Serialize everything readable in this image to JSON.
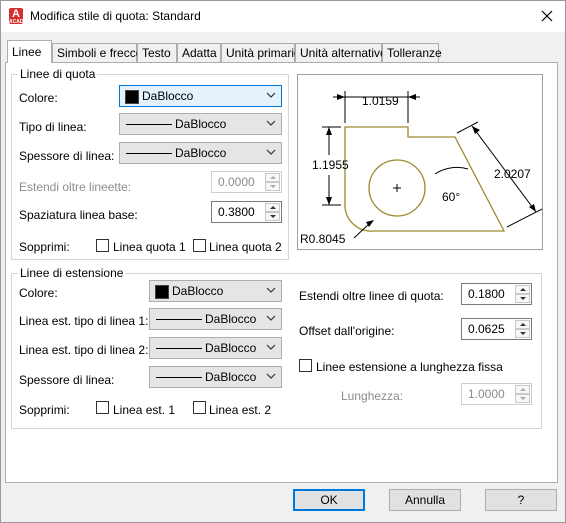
{
  "window": {
    "title": "Modifica stile di quota: Standard",
    "app_icon_letter": "A",
    "app_icon_sub": "ACAD"
  },
  "tabs": [
    "Linee",
    "Simboli e frecce",
    "Testo",
    "Adatta",
    "Unità primarie",
    "Unità alternative",
    "Tolleranze"
  ],
  "active_tab": "Linee",
  "dim_lines": {
    "group_title": "Linee di quota",
    "color_label": "Colore:",
    "color_value": "DaBlocco",
    "linetype_label": "Tipo di linea:",
    "linetype_value": "DaBlocco",
    "lineweight_label": "Spessore di linea:",
    "lineweight_value": "DaBlocco",
    "extend_label": "Estendi oltre lineette:",
    "extend_value": "0.0000",
    "baseline_label": "Spaziatura linea base:",
    "baseline_value": "0.3800",
    "suppress_label": "Sopprimi:",
    "suppress_1": "Linea quota 1",
    "suppress_2": "Linea quota 2"
  },
  "ext_lines": {
    "group_title": "Linee di estensione",
    "color_label": "Colore:",
    "color_value": "DaBlocco",
    "linetype1_label": "Linea est. tipo di linea 1:",
    "linetype1_value": "DaBlocco",
    "linetype2_label": "Linea est. tipo di linea 2:",
    "linetype2_value": "DaBlocco",
    "lineweight_label": "Spessore di linea:",
    "lineweight_value": "DaBlocco",
    "suppress_label": "Sopprimi:",
    "suppress_1": "Linea est. 1",
    "suppress_2": "Linea est. 2",
    "extend_label": "Estendi oltre linee di quota:",
    "extend_value": "0.1800",
    "offset_label": "Offset dall'origine:",
    "offset_value": "0.0625",
    "fixed_label": "Linee estensione a lunghezza fissa",
    "length_label": "Lunghezza:",
    "length_value": "1.0000"
  },
  "preview": {
    "dim_top": "1.0159",
    "dim_left": "1.1955",
    "dim_right": "2.0207",
    "dim_angle": "60°",
    "dim_radius": "R0.8045"
  },
  "buttons": {
    "ok": "OK",
    "cancel": "Annulla",
    "help": "?"
  }
}
